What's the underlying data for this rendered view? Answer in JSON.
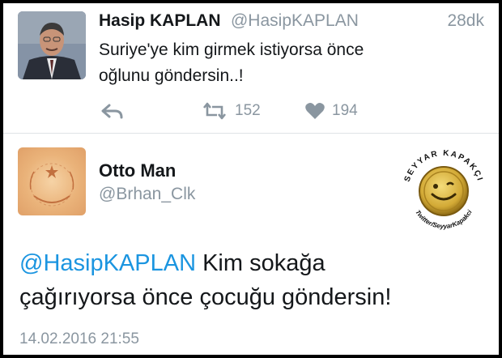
{
  "tweet1": {
    "author_name": "Hasip KAPLAN",
    "author_handle": "@HasipKAPLAN",
    "relative_time": "28dk",
    "text_line1": "Suriye'ye kim girmek istiyorsa önce",
    "text_line2": "oğlunu göndersin..!",
    "retweet_count": "152",
    "like_count": "194",
    "icons": [
      "reply-icon",
      "retweet-icon",
      "heart-icon"
    ]
  },
  "tweet2": {
    "author_name": "Otto Man",
    "author_handle": "@Brhan_Clk",
    "mention": "@HasipKAPLAN",
    "text_rest": " Kim sokağa",
    "text_line2": "çağırıyorsa önce çocuğu göndersin!",
    "date": "14.02.2016 21:55"
  },
  "watermark": {
    "top_text": "SEYYAR KAPAKÇI",
    "bottom_text": "Twitter/SeyyarKapakci"
  },
  "colors": {
    "link": "#1b95e0",
    "muted": "#8a96a0",
    "text": "#14171a",
    "divider": "#dfe3e6",
    "cap_gold": "#c9a227"
  }
}
